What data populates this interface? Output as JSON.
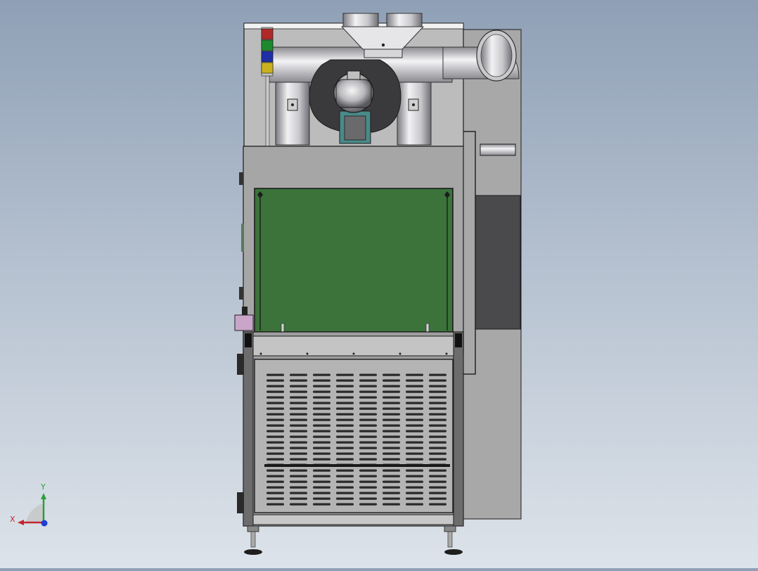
{
  "viewport": {
    "view": "front",
    "model": "dust-collector-cabinet",
    "background": [
      "#8fa0b6",
      "#dde3ea"
    ]
  },
  "axis_triad": {
    "x_label": "X",
    "y_label": "Y",
    "colors": {
      "x": "#c4262e",
      "y": "#2f9e3a",
      "z": "#1f3fd0"
    }
  },
  "signal_tower": {
    "lights": [
      {
        "name": "red",
        "color": "#b02a2a"
      },
      {
        "name": "green",
        "color": "#1e8a2e"
      },
      {
        "name": "blue",
        "color": "#1e2fa8"
      },
      {
        "name": "yellow",
        "color": "#c9b21e"
      }
    ]
  },
  "colors": {
    "body": "#a6a6a6",
    "body_light": "#bdbdbd",
    "window": "#3b733b",
    "dark_panel": "#4a4a4c",
    "outline": "#1c1c1c",
    "valve": "#c9a6c9"
  }
}
